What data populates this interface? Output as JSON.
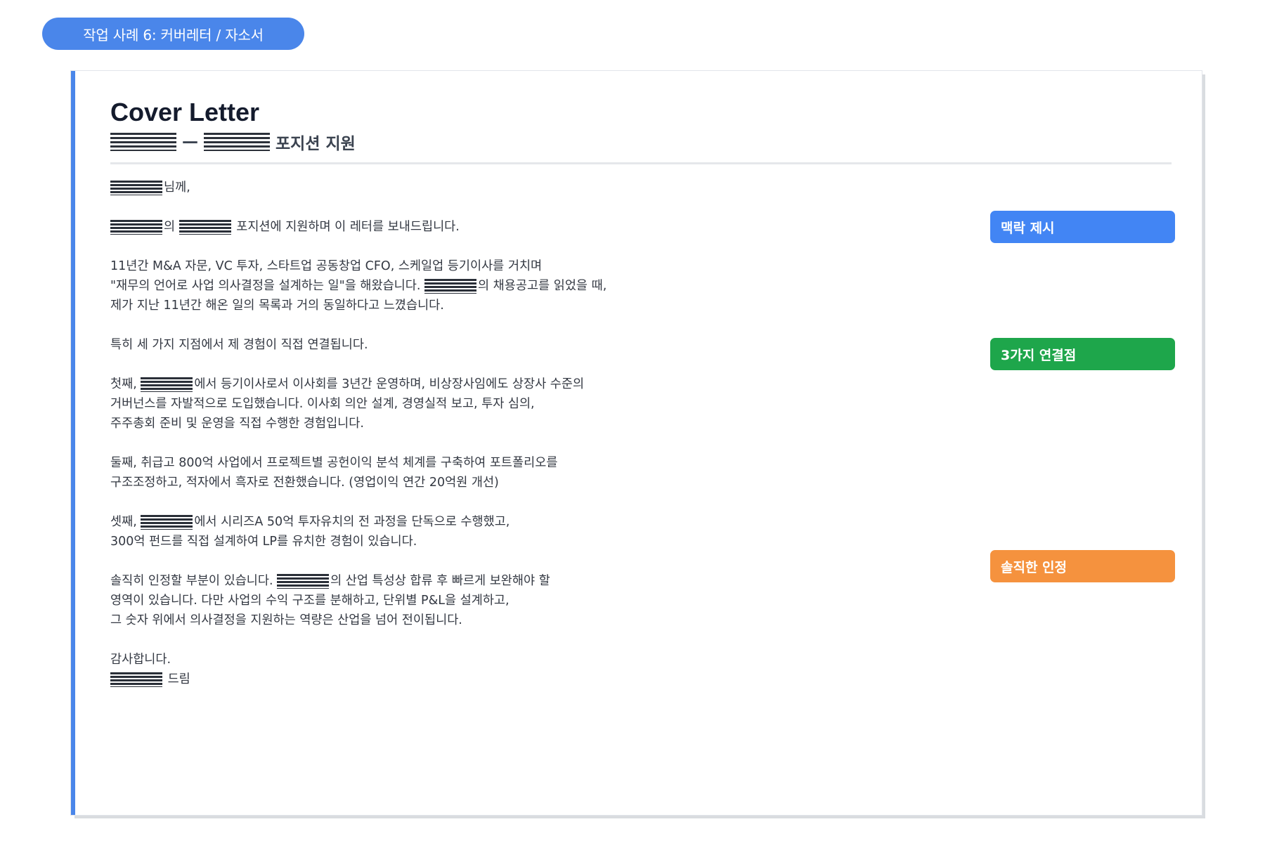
{
  "header": {
    "pill_label": "작업 사례 6: 커버레터 / 자소서"
  },
  "letter": {
    "title": "Cover Letter",
    "subtitle_dash": "—",
    "subtitle_suffix": "포지션 지원",
    "paragraphs": [
      [
        [
          {
            "t": "mask"
          },
          {
            "t": "text",
            "v": "님께,"
          }
        ]
      ],
      [
        [
          {
            "t": "mask"
          },
          {
            "t": "text",
            "v": "의 "
          },
          {
            "t": "mask"
          },
          {
            "t": "text",
            "v": " 포지션에 지원하며 이 레터를 보내드립니다."
          }
        ]
      ],
      [
        [
          {
            "t": "text",
            "v": "11년간 M&A 자문, VC 투자, 스타트업 공동창업 CFO, 스케일업 등기이사를 거치며"
          }
        ],
        [
          {
            "t": "text",
            "v": "\"재무의 언어로 사업 의사결정을 설계하는 일\"을 해왔습니다. "
          },
          {
            "t": "mask"
          },
          {
            "t": "text",
            "v": "의 채용공고를 읽었을 때,"
          }
        ],
        [
          {
            "t": "text",
            "v": "제가 지난 11년간 해온 일의 목록과 거의 동일하다고 느꼈습니다."
          }
        ]
      ],
      [
        [
          {
            "t": "text",
            "v": "특히 세 가지 지점에서 제 경험이 직접 연결됩니다."
          }
        ]
      ],
      [
        [
          {
            "t": "text",
            "v": "첫째, "
          },
          {
            "t": "mask"
          },
          {
            "t": "text",
            "v": "에서 등기이사로서 이사회를 3년간 운영하며, 비상장사임에도 상장사 수준의"
          }
        ],
        [
          {
            "t": "text",
            "v": "거버넌스를 자발적으로 도입했습니다. 이사회 의안 설계, 경영실적 보고, 투자 심의,"
          }
        ],
        [
          {
            "t": "text",
            "v": "주주총회 준비 및 운영을 직접 수행한 경험입니다."
          }
        ]
      ],
      [
        [
          {
            "t": "text",
            "v": "둘째, 취급고 800억 사업에서 프로젝트별 공헌이익 분석 체계를 구축하여 포트폴리오를"
          }
        ],
        [
          {
            "t": "text",
            "v": "구조조정하고, 적자에서 흑자로 전환했습니다. (영업이익 연간 20억원 개선)"
          }
        ]
      ],
      [
        [
          {
            "t": "text",
            "v": "셋째, "
          },
          {
            "t": "mask"
          },
          {
            "t": "text",
            "v": "에서 시리즈A 50억 투자유치의 전 과정을 단독으로 수행했고,"
          }
        ],
        [
          {
            "t": "text",
            "v": "300억 펀드를 직접 설계하여 LP를 유치한 경험이 있습니다."
          }
        ]
      ],
      [
        [
          {
            "t": "text",
            "v": "솔직히 인정할 부분이 있습니다. "
          },
          {
            "t": "mask"
          },
          {
            "t": "text",
            "v": "의 산업 특성상 합류 후 빠르게 보완해야 할"
          }
        ],
        [
          {
            "t": "text",
            "v": "영역이 있습니다. 다만 사업의 수익 구조를 분해하고, 단위별 P&L을 설계하고,"
          }
        ],
        [
          {
            "t": "text",
            "v": "그 숫자 위에서 의사결정을 지원하는 역량은 산업을 넘어 전이됩니다."
          }
        ]
      ],
      [
        [
          {
            "t": "text",
            "v": "감사합니다."
          }
        ],
        [
          {
            "t": "mask"
          },
          {
            "t": "text",
            "v": " 드림"
          }
        ]
      ]
    ]
  },
  "tags": [
    {
      "label": "맥락 제시",
      "color": "#4285f4"
    },
    {
      "label": "3가지 연결점",
      "color": "#1ea64b"
    },
    {
      "label": "솔직한 인정",
      "color": "#f5923e"
    }
  ]
}
